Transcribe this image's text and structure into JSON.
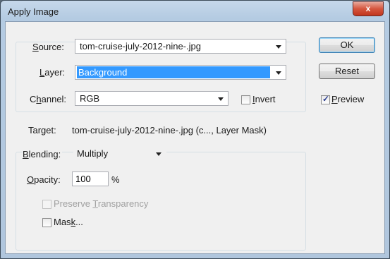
{
  "window": {
    "title": "Apply Image",
    "close_glyph": "x"
  },
  "source": {
    "label_u": "S",
    "label_rest": "ource:",
    "value": "tom-cruise-july-2012-nine-.jpg",
    "layer_label_u": "L",
    "layer_label_rest": "ayer:",
    "layer_value": "Background",
    "channel_label_pre": "C",
    "channel_label_u": "h",
    "channel_label_rest": "annel:",
    "channel_value": "RGB",
    "invert_u": "I",
    "invert_rest": "nvert",
    "invert_checked": false
  },
  "target": {
    "label": "Target:",
    "value": "tom-cruise-july-2012-nine-.jpg (c..., Layer Mask)"
  },
  "blending": {
    "label_u": "B",
    "label_rest": "lending:",
    "mode": "Multiply",
    "opacity_label_u": "O",
    "opacity_label_rest": "pacity:",
    "opacity_value": "100",
    "opacity_unit": "%",
    "preserve_pre": "Preserve ",
    "preserve_u": "T",
    "preserve_rest": "ransparency",
    "preserve_checked": false,
    "mask_pre": "Mas",
    "mask_u": "k",
    "mask_rest": "...",
    "mask_checked": false
  },
  "buttons": {
    "ok": "OK",
    "reset": "Reset"
  },
  "preview": {
    "u": "P",
    "rest": "review",
    "checked": true
  },
  "colors": {
    "selection": "#3399ff",
    "close": "#c0361e"
  }
}
